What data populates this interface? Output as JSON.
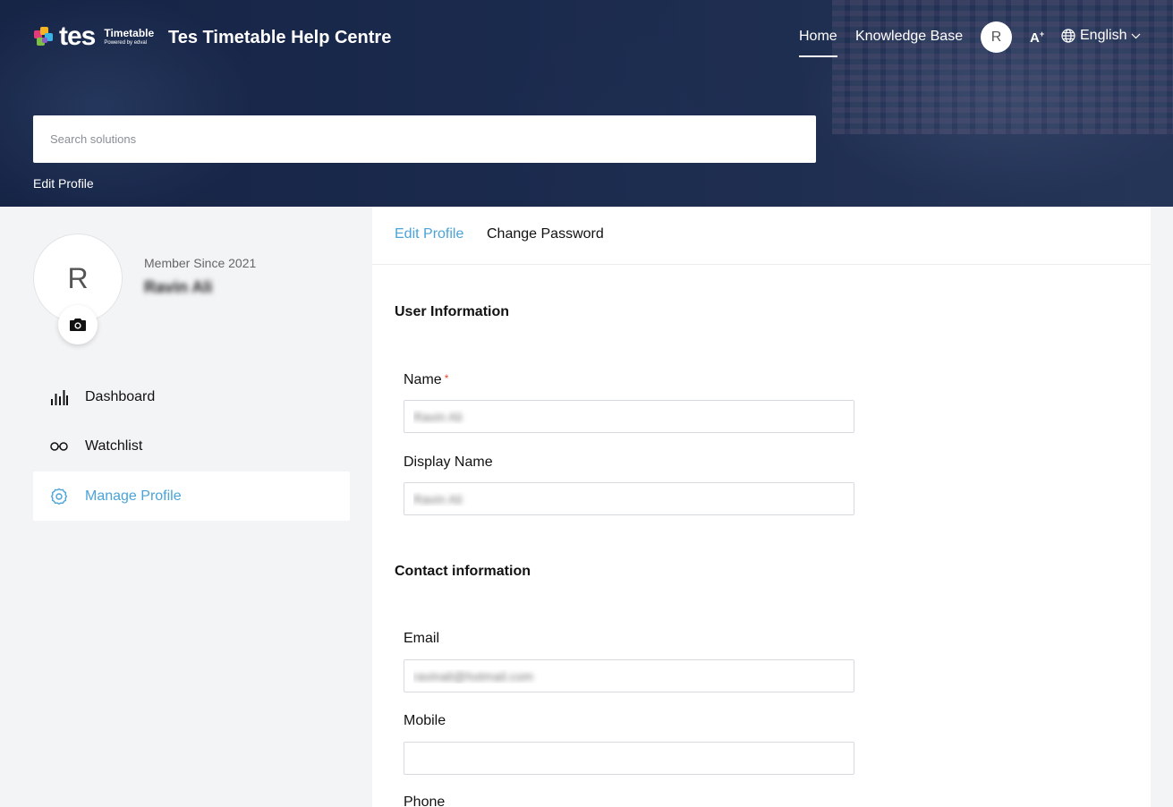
{
  "header": {
    "logo_word": "tes",
    "logo_product": "Timetable",
    "logo_powered": "Powered by edval",
    "site_title": "Tes Timetable Help Centre",
    "nav": {
      "home": "Home",
      "knowledge_base": "Knowledge Base",
      "language": "English"
    },
    "avatar_initial": "R",
    "font_size_label": "A",
    "search_placeholder": "Search solutions",
    "breadcrumb": "Edit Profile"
  },
  "profile": {
    "avatar_initial": "R",
    "member_since": "Member Since 2021",
    "name": "Ravin Ali"
  },
  "sidebar": {
    "items": [
      {
        "label": "Dashboard",
        "icon": "bar-chart-icon",
        "active": false
      },
      {
        "label": "Watchlist",
        "icon": "glasses-icon",
        "active": false
      },
      {
        "label": "Manage Profile",
        "icon": "gear-icon",
        "active": true
      }
    ]
  },
  "tabs": {
    "edit_profile": "Edit Profile",
    "change_password": "Change Password"
  },
  "form": {
    "user_info_title": "User Information",
    "name_label": "Name",
    "name_required": "*",
    "name_value": "Ravin Ali",
    "display_name_label": "Display Name",
    "display_name_value": "Ravin Ali",
    "contact_title": "Contact information",
    "email_label": "Email",
    "email_value": "ravinali@hotmail.com",
    "mobile_label": "Mobile",
    "mobile_value": "",
    "phone_label": "Phone"
  },
  "colors": {
    "accent": "#4aa3d9",
    "required": "#e04b2b",
    "hero": "#22345a"
  }
}
